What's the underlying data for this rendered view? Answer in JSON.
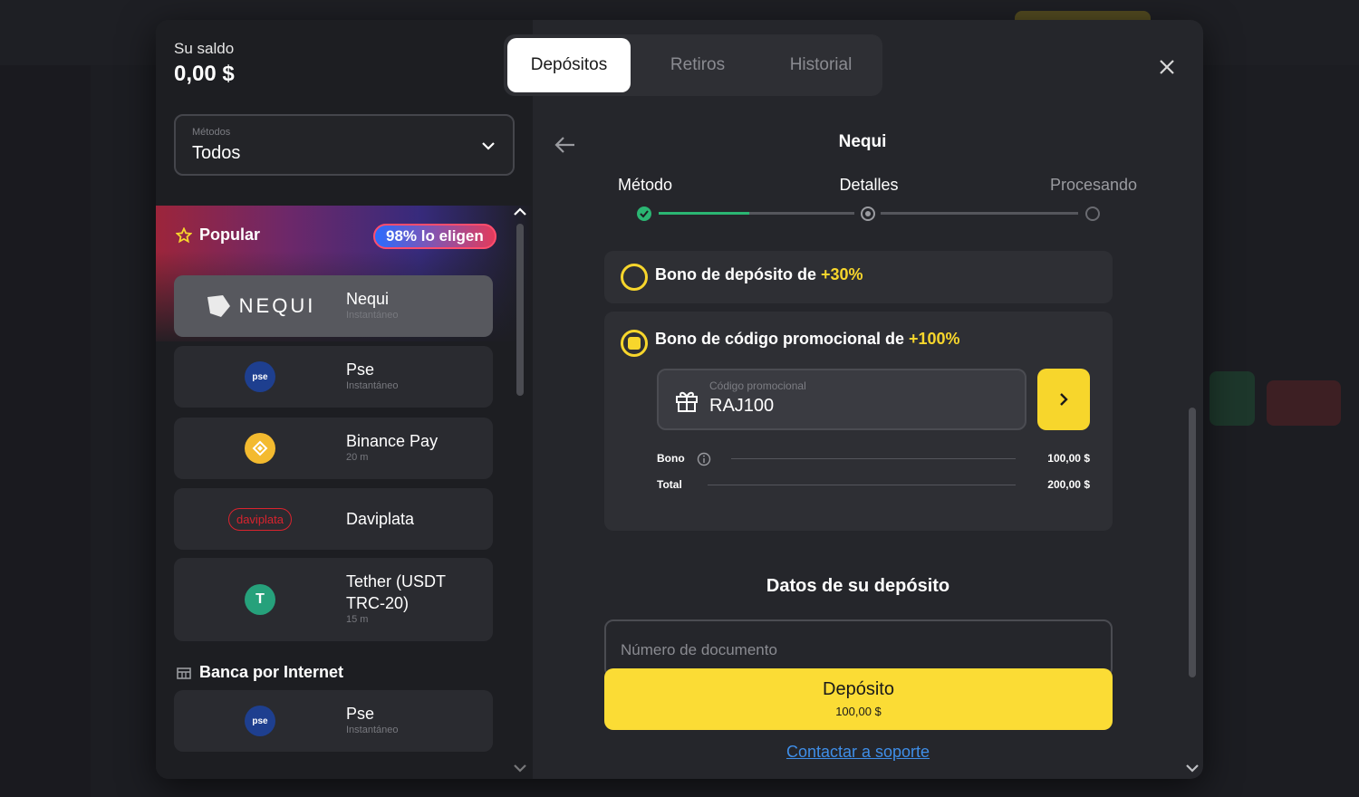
{
  "balance": {
    "label": "Su saldo",
    "value": "0,00 $"
  },
  "methods_filter": {
    "label": "Métodos",
    "value": "Todos"
  },
  "tabs": [
    {
      "label": "Depósitos",
      "active": true
    },
    {
      "label": "Retiros",
      "active": false
    },
    {
      "label": "Historial",
      "active": false
    }
  ],
  "popular": {
    "title": "Popular",
    "badge": "98% lo eligen"
  },
  "methods": [
    {
      "logo_text": "NEQUI",
      "name": "Nequi",
      "sub": "Instantáneo",
      "active": true
    },
    {
      "logo_text": "pse",
      "name": "Pse",
      "sub": "Instantáneo"
    },
    {
      "logo_text": "",
      "name": "Binance Pay",
      "sub": "20 m"
    },
    {
      "logo_text": "daviplata",
      "name": "Daviplata",
      "sub": ""
    },
    {
      "logo_text": "T",
      "name": "Tether (USDT TRC-20)",
      "sub": "15 m"
    }
  ],
  "internet_banking": {
    "title": "Banca por Internet",
    "items": [
      {
        "logo_text": "pse",
        "name": "Pse",
        "sub": "Instantáneo"
      }
    ]
  },
  "detail": {
    "title": "Nequi",
    "steps": [
      "Método",
      "Detalles",
      "Procesando"
    ],
    "bonus_deposit": {
      "text": "Bono de depósito de ",
      "pct": "+30%"
    },
    "bonus_promo": {
      "text": "Bono de código promocional de ",
      "pct": "+100%"
    },
    "promo_field": {
      "label": "Código promocional",
      "value": "RAJ100"
    },
    "summary": {
      "bonus_label": "Bono",
      "bonus_value": "100,00 $",
      "total_label": "Total",
      "total_value": "200,00 $"
    },
    "data_title": "Datos de su depósito",
    "doc_placeholder": "Número de documento",
    "deposit_button": {
      "label": "Depósito",
      "amount": "100,00 $"
    },
    "support_link": "Contactar a soporte"
  },
  "colors": {
    "accent": "#f7d62c",
    "active_step": "#2bb673",
    "link": "#3f8ee8"
  },
  "icons": [
    "chevron-down-icon",
    "star-icon",
    "bank-icon",
    "close-icon",
    "arrow-left-icon",
    "gift-icon",
    "chevron-right-icon",
    "info-icon",
    "check-icon"
  ]
}
